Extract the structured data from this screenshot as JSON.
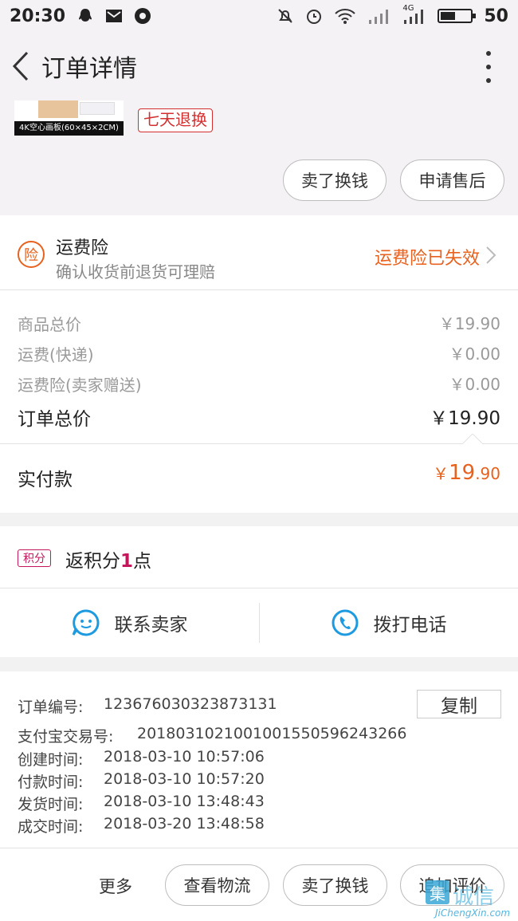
{
  "status_bar": {
    "time": "20:30",
    "network": "4G",
    "battery": "50",
    "icons": [
      "qq-icon",
      "mail-icon",
      "aperture-icon",
      "mute-icon",
      "alarm-icon",
      "wifi-icon",
      "signal-icon",
      "signal-icon",
      "battery-icon"
    ]
  },
  "header": {
    "title": "订单详情"
  },
  "product": {
    "image_caption": "4K空心画板(60×45×2CM)",
    "return_tag": "七天退换",
    "actions": [
      "卖了换钱",
      "申请售后"
    ]
  },
  "insurance": {
    "icon_char": "险",
    "title": "运费险",
    "subtitle": "确认收货前退货可理赔",
    "status": "运费险已失效",
    "accent": "#e8611e"
  },
  "price": {
    "rows": [
      {
        "label": "商品总价",
        "value": "￥19.90"
      },
      {
        "label": "运费(快递)",
        "value": "￥0.00"
      },
      {
        "label": "运费险(卖家赠送)",
        "value": "￥0.00"
      }
    ],
    "total_label": "订单总价",
    "total_value": "￥19.90",
    "paid_label": "实付款",
    "paid_symbol": "￥",
    "paid_int": "19",
    "paid_dec": ".90"
  },
  "points": {
    "tag": "积分",
    "prefix": "返积分",
    "num": "1",
    "suffix": "点"
  },
  "contact": {
    "seller": "联系卖家",
    "phone": "拨打电话"
  },
  "order_info": {
    "order_no_label": "订单编号:",
    "order_no": "123676030323873131",
    "copy": "复制",
    "alipay_label": "支付宝交易号:",
    "alipay_no": "2018031021001001550596243266",
    "created_label": "创建时间:",
    "created": "2018-03-10 10:57:06",
    "paid_label": "付款时间:",
    "paid": "2018-03-10 10:57:20",
    "shipped_label": "发货时间:",
    "shipped": "2018-03-10 13:48:43",
    "done_label": "成交时间:",
    "done": "2018-03-20 13:48:58"
  },
  "bottom_bar": {
    "more": "更多",
    "buttons": [
      "查看物流",
      "卖了换钱",
      "追加评价"
    ]
  },
  "watermark": {
    "logo_char": "集",
    "text": "诚信",
    "url": "JiChengXin.com"
  }
}
